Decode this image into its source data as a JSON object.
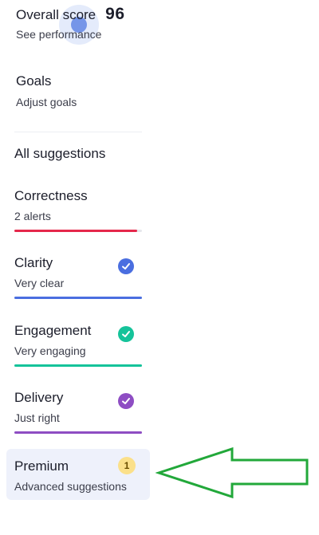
{
  "score": {
    "title": "Overall score",
    "value": "96",
    "link": "See performance"
  },
  "goals": {
    "title": "Goals",
    "link": "Adjust goals"
  },
  "suggestions": {
    "header": "All suggestions",
    "items": [
      {
        "name": "Correctness",
        "desc": "2 alerts",
        "color": "#e5284b",
        "fill": 0.96,
        "check": false
      },
      {
        "name": "Clarity",
        "desc": "Very clear",
        "color": "#4a6ee0",
        "fill": 1.0,
        "check": true
      },
      {
        "name": "Engagement",
        "desc": "Very engaging",
        "color": "#15c39a",
        "fill": 1.0,
        "check": true
      },
      {
        "name": "Delivery",
        "desc": "Just right",
        "color": "#8e4dc3",
        "fill": 1.0,
        "check": true
      }
    ]
  },
  "premium": {
    "name": "Premium",
    "desc": "Advanced suggestions",
    "badge": "1",
    "badge_color": "#fbe08a"
  },
  "annotation": {
    "arrow_color": "#22a83a",
    "arrow_icon": "arrow-left-icon"
  }
}
